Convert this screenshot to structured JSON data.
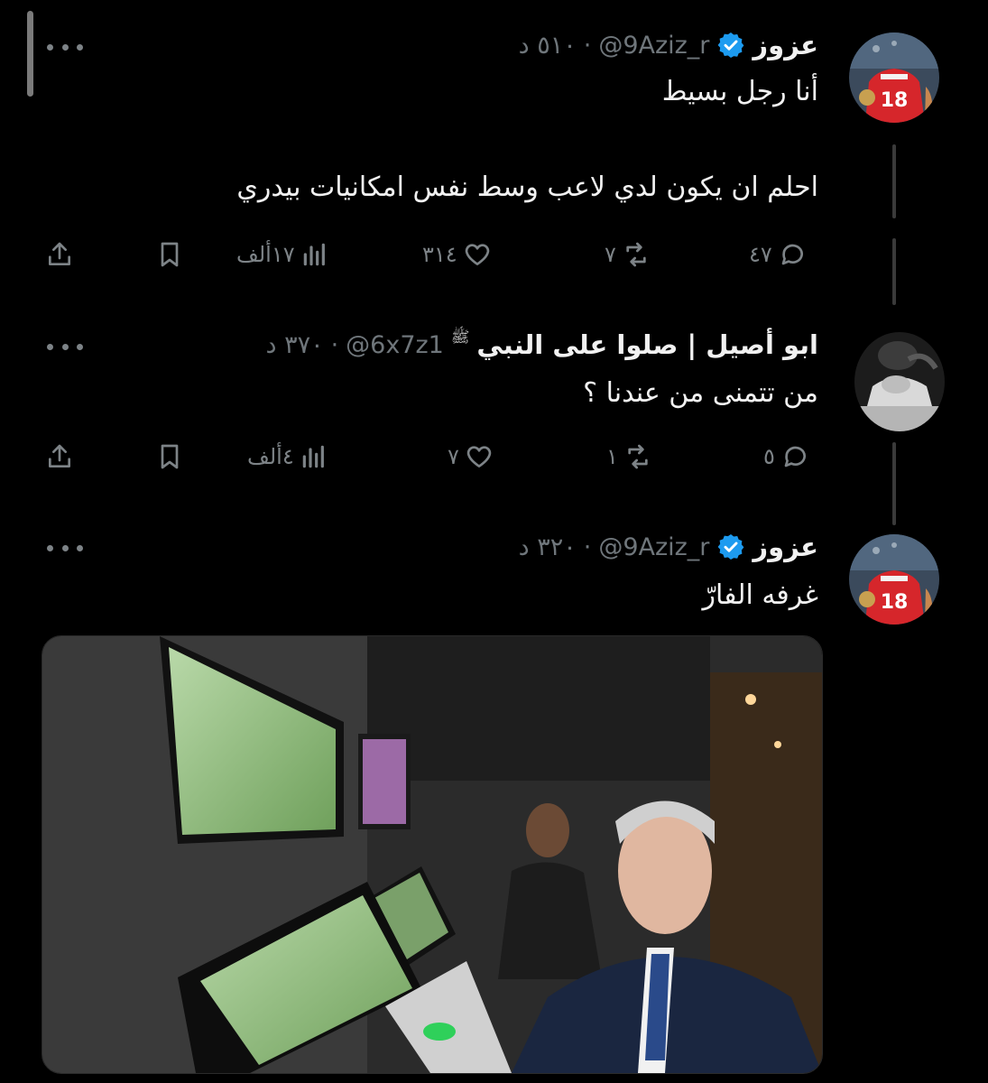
{
  "colors": {
    "background": "#000000",
    "text_primary": "#f1f1f1",
    "text_secondary": "#6f767b",
    "verified_blue": "#1d9bf0",
    "thread_line": "#3a3a3a"
  },
  "tweets": [
    {
      "display_name": "عزوز",
      "verified": true,
      "handle": "@9Aziz_r",
      "separator": "·",
      "time": "٥١٠ د",
      "text_lines": [
        "أنا رجل بسيط",
        "احلم ان يكون لدي لاعب وسط نفس امكانيات بيدري"
      ],
      "replies": "٤٧",
      "retweets": "٧",
      "likes": "٣١٤",
      "views": "١٧ألف",
      "avatar_icon": "football-player-avatar"
    },
    {
      "display_name": "ابو أصيل | صلوا على النبي",
      "honorific": "ﷺ",
      "verified": false,
      "handle": "@6x7z1",
      "separator": "·",
      "time": "٣٧٠ د",
      "text_lines": [
        "من تتمنى من عندنا ؟"
      ],
      "replies": "٥",
      "retweets": "١",
      "likes": "٧",
      "views": "٤ألف",
      "avatar_icon": "monochrome-player-avatar"
    },
    {
      "display_name": "عزوز",
      "verified": true,
      "handle": "@9Aziz_r",
      "separator": "·",
      "time": "٣٢٠ د",
      "text_lines": [
        "غرفه الفارّ"
      ],
      "media": "var-room-photo",
      "avatar_icon": "football-player-avatar"
    }
  ],
  "icons": {
    "reply": "reply-icon",
    "retweet": "retweet-icon",
    "like": "like-icon",
    "views": "views-icon",
    "bookmark": "bookmark-icon",
    "share": "share-icon",
    "more": "more-icon",
    "verified": "verified-badge-icon"
  }
}
